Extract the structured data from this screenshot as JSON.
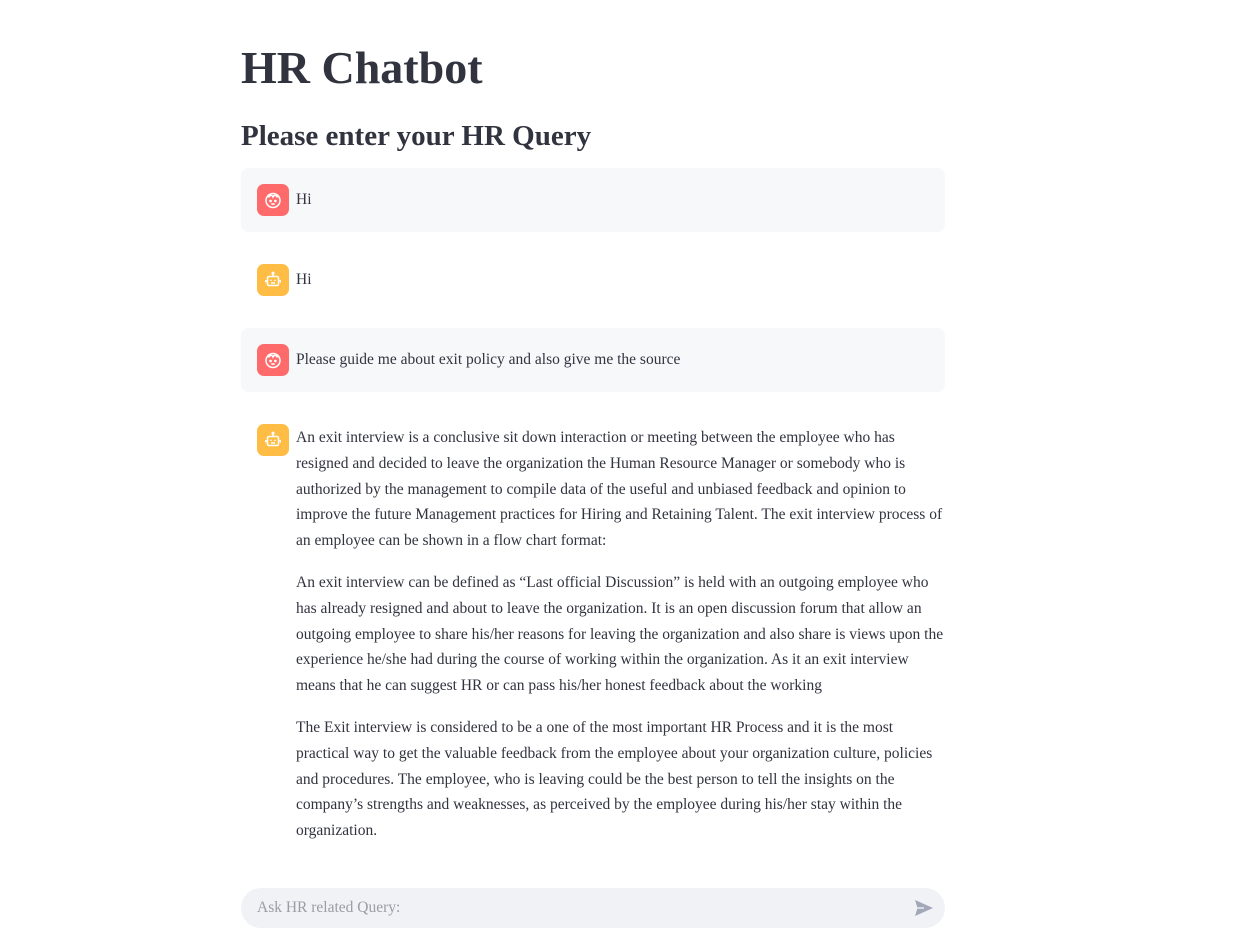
{
  "page": {
    "title": "HR Chatbot",
    "subtitle": "Please enter your HR Query"
  },
  "colors": {
    "text": "#31333f",
    "user_avatar": "#ff6b6b",
    "bot_avatar": "#ffbd45",
    "user_bubble": "#f7f8fa",
    "input_bg": "#f0f2f6"
  },
  "messages": [
    {
      "role": "user",
      "icon": "user-face-icon",
      "paragraphs": [
        "Hi"
      ]
    },
    {
      "role": "assistant",
      "icon": "robot-icon",
      "paragraphs": [
        "Hi"
      ]
    },
    {
      "role": "user",
      "icon": "user-face-icon",
      "paragraphs": [
        "Please guide me about exit policy and also give me the source"
      ]
    },
    {
      "role": "assistant",
      "icon": "robot-icon",
      "paragraphs": [
        "An exit interview is a conclusive sit down interaction or meeting between the employee who has resigned and decided to leave the organization the Human Resource Manager or somebody who is authorized by the management to compile data of the useful and unbiased feedback and opinion to improve the future Management practices for Hiring and Retaining Talent. The exit interview process of an employee can be shown in a flow chart format:",
        "An exit interview can be defined as “Last official Discussion” is held with an outgoing employee who has already resigned and about to leave the organization. It is an open discussion forum that allow an outgoing employee to share his/her reasons for leaving the organization and also share is views upon the experience he/she had during the course of working within the organization. As it an exit interview means that he can suggest HR or can pass his/her honest feedback about the working",
        "The Exit interview is considered to be a one of the most important HR Process and it is the most practical way to get the valuable feedback from the employee about your organization culture, policies and procedures. The employee, who is leaving could be the best person to tell the insights on the company’s strengths and weaknesses, as perceived by the employee during his/her stay within the organization."
      ]
    }
  ],
  "chat_input": {
    "placeholder": "Ask HR related Query:",
    "value": "",
    "send_icon": "send-icon"
  }
}
